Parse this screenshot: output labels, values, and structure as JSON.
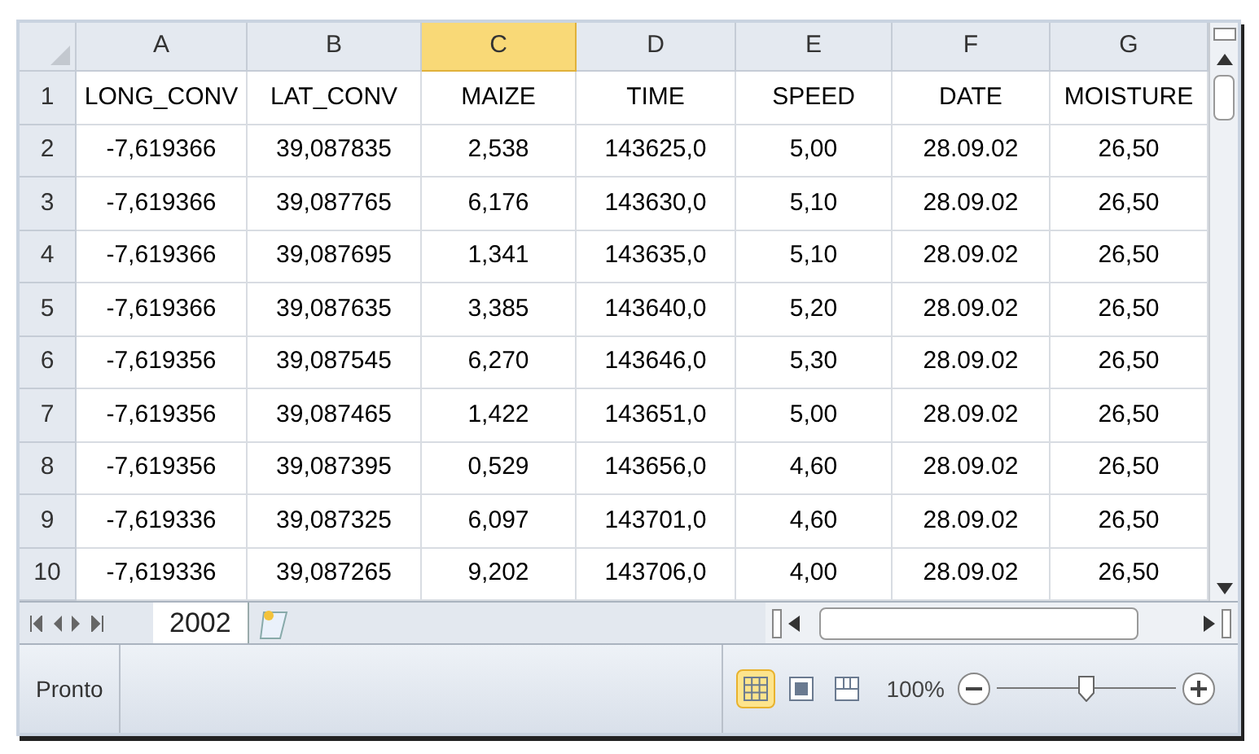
{
  "columns": [
    {
      "label": "A",
      "selected": false
    },
    {
      "label": "B",
      "selected": false
    },
    {
      "label": "C",
      "selected": true
    },
    {
      "label": "D",
      "selected": false
    },
    {
      "label": "E",
      "selected": false
    },
    {
      "label": "F",
      "selected": false
    },
    {
      "label": "G",
      "selected": false
    }
  ],
  "rows": [
    {
      "number": "1",
      "cells": [
        "LONG_CONV",
        "LAT_CONV",
        "MAIZE",
        "TIME",
        "SPEED",
        "DATE",
        "MOISTURE"
      ]
    },
    {
      "number": "2",
      "cells": [
        "-7,619366",
        "39,087835",
        "2,538",
        "143625,0",
        "5,00",
        "28.09.02",
        "26,50"
      ]
    },
    {
      "number": "3",
      "cells": [
        "-7,619366",
        "39,087765",
        "6,176",
        "143630,0",
        "5,10",
        "28.09.02",
        "26,50"
      ]
    },
    {
      "number": "4",
      "cells": [
        "-7,619366",
        "39,087695",
        "1,341",
        "143635,0",
        "5,10",
        "28.09.02",
        "26,50"
      ]
    },
    {
      "number": "5",
      "cells": [
        "-7,619366",
        "39,087635",
        "3,385",
        "143640,0",
        "5,20",
        "28.09.02",
        "26,50"
      ]
    },
    {
      "number": "6",
      "cells": [
        "-7,619356",
        "39,087545",
        "6,270",
        "143646,0",
        "5,30",
        "28.09.02",
        "26,50"
      ]
    },
    {
      "number": "7",
      "cells": [
        "-7,619356",
        "39,087465",
        "1,422",
        "143651,0",
        "5,00",
        "28.09.02",
        "26,50"
      ]
    },
    {
      "number": "8",
      "cells": [
        "-7,619356",
        "39,087395",
        "0,529",
        "143656,0",
        "4,60",
        "28.09.02",
        "26,50"
      ]
    },
    {
      "number": "9",
      "cells": [
        "-7,619336",
        "39,087325",
        "6,097",
        "143701,0",
        "4,60",
        "28.09.02",
        "26,50"
      ]
    },
    {
      "number": "10",
      "cells": [
        "-7,619336",
        "39,087265",
        "9,202",
        "143706,0",
        "4,00",
        "28.09.02",
        "26,50"
      ]
    }
  ],
  "sheet_tabs": [
    {
      "label": "2002",
      "selected": true
    }
  ],
  "status_bar": {
    "status": "Pronto",
    "views": [
      {
        "kind": "normal",
        "selected": true
      },
      {
        "kind": "page-layout",
        "selected": false
      },
      {
        "kind": "page-break",
        "selected": false
      }
    ],
    "zoom": "100%",
    "zoom_level": {
      "level": 0.5
    }
  }
}
